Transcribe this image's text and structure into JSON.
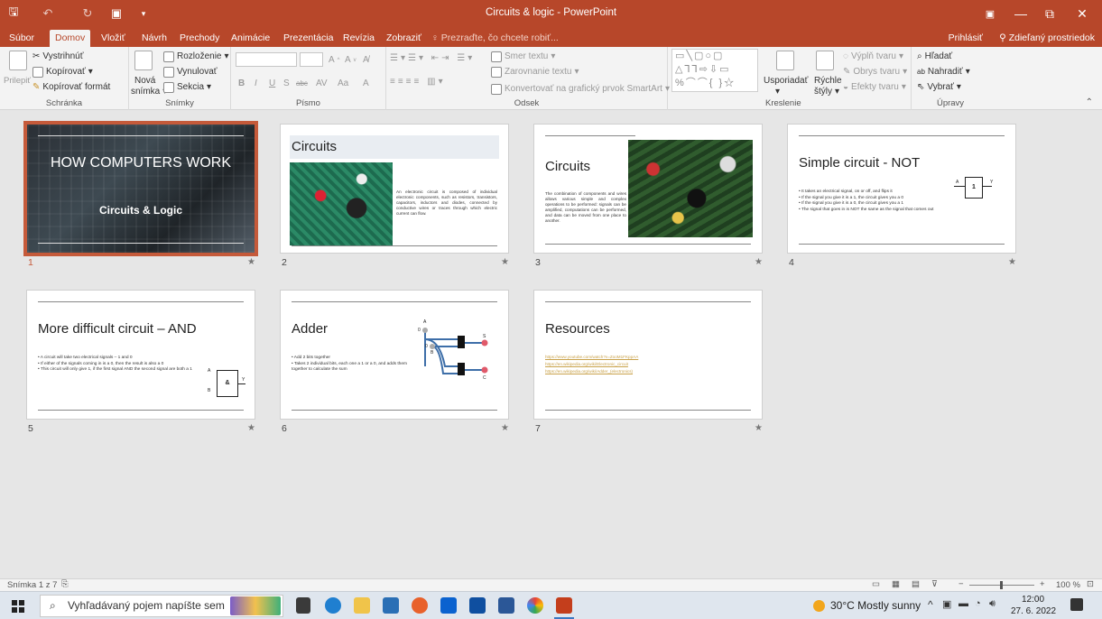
{
  "window": {
    "title": "Circuits & logic - PowerPoint",
    "min_glyph": "—",
    "restore_glyph": "⧉",
    "close_glyph": "✕"
  },
  "tabs": [
    {
      "label": "Súbor",
      "active": false
    },
    {
      "label": "Domov",
      "active": true
    },
    {
      "label": "Vložiť",
      "active": false
    },
    {
      "label": "Návrh",
      "active": false
    },
    {
      "label": "Prechody",
      "active": false
    },
    {
      "label": "Animácie",
      "active": false
    },
    {
      "label": "Prezentácia",
      "active": false
    },
    {
      "label": "Revízia",
      "active": false
    },
    {
      "label": "Zobraziť",
      "active": false
    }
  ],
  "tell_me": "Prezraďte, čo chcete robiť...",
  "sign_in": "Prihlásiť",
  "share": "Zdieľaný prostriedok",
  "ribbon": {
    "clipboard": {
      "paste": "Prilepiť",
      "cut": "Vystrihnúť",
      "copy": "Kopírovať",
      "format_painter": "Kopírovať formát",
      "label": "Schránka"
    },
    "slides": {
      "new_slide_1": "Nová",
      "new_slide_2": "snímka",
      "layout": "Rozloženie",
      "reset": "Vynulovať",
      "section": "Sekcia",
      "label": "Snímky"
    },
    "font": {
      "bold": "B",
      "italic": "I",
      "underline": "U",
      "shadow": "S",
      "strike": "abc",
      "spacing": "AV",
      "case": "Aa",
      "color": "A",
      "label": "Písmo"
    },
    "paragraph": {
      "text_direction": "Smer textu",
      "align_text": "Zarovnanie textu",
      "smartart": "Konvertovať na grafický prvok SmartArt",
      "label": "Odsek"
    },
    "drawing": {
      "arrange": "Usporiadať",
      "quick_styles_1": "Rýchle",
      "quick_styles_2": "štýly",
      "fill": "Výplň tvaru",
      "outline": "Obrys tvaru",
      "effects": "Efekty tvaru",
      "label": "Kreslenie"
    },
    "editing": {
      "find": "Hľadať",
      "replace": "Nahradiť",
      "select": "Vybrať",
      "label": "Úpravy"
    }
  },
  "slides": [
    {
      "num": "1",
      "title": "HOW COMPUTERS WORK",
      "subtitle": "Circuits & Logic"
    },
    {
      "num": "2",
      "title": "Circuits",
      "body": "An electronic circuit is composed of individual electronic components, such as resistors, transistors, capacitors, inductors and diodes, connected by conductive wires or traces through which electric current can flow."
    },
    {
      "num": "3",
      "title": "Circuits",
      "body": "The combination of components and wires allows various simple and complex operations to be performed: signals can be amplified, computations can be performed, and data can be moved from one place to another."
    },
    {
      "num": "4",
      "title": "Simple circuit - NOT",
      "bullets": [
        "It takes an electrical signal, on or off, and flips it",
        "If the signal you give it is a 1, the circuit gives you a 0",
        "If the signal you give it is a 0, the circuit gives you a 1",
        "The signal that goes in is NOT the same as the signal that comes out"
      ],
      "gate": "1",
      "in": "A",
      "out": "Y"
    },
    {
      "num": "5",
      "title": "More difficult circuit – AND",
      "bullets": [
        "A circuit will take two electrical signals – 1 and 0",
        "If either of the signals coming in is a 0, then the result is also a 0",
        "This circuit will only give 1, if the first signal AND the second signal are both a 1"
      ],
      "gate": "&",
      "in_a": "A",
      "in_b": "B",
      "out": "Y"
    },
    {
      "num": "6",
      "title": "Adder",
      "bullets": [
        "Add 2 bits together",
        "Takes 2 individual bits, each one a 1 or a 0, and adds them together to calculate the sum"
      ],
      "labels": {
        "a": "A",
        "b": "B",
        "s": "S",
        "c": "C",
        "zero1": "0",
        "zero2": "0"
      }
    },
    {
      "num": "7",
      "title": "Resources",
      "links": [
        "https://www.youtube.com/watch?v=ZooM1FKppAA",
        "https://en.wikipedia.org/wiki/Electronic_circuit",
        "https://en.wikipedia.org/wiki/Adder_(electronics)"
      ]
    }
  ],
  "status": {
    "slide_info": "Snímka 1 z 7",
    "zoom": "100 %"
  },
  "taskbar": {
    "search_placeholder": "Vyhľadávaný pojem napíšte sem",
    "weather": "30°C  Mostly sunny",
    "time": "12:00",
    "date": "27. 6. 2022"
  }
}
